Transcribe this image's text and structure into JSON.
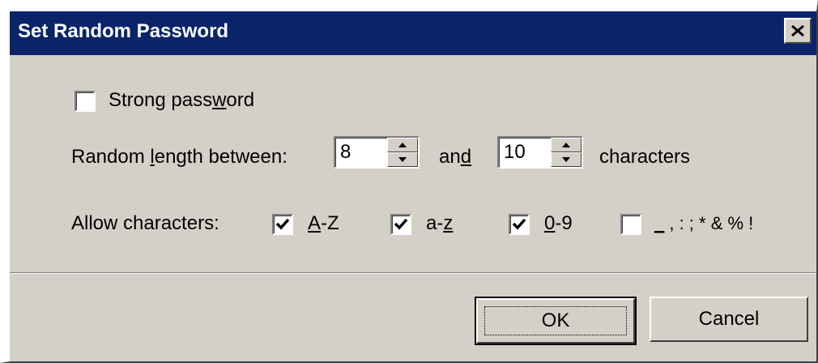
{
  "dialog": {
    "title": "Set Random Password",
    "close_glyph": "✕"
  },
  "strong_password": {
    "checked": false,
    "label_pre": "Strong pass",
    "label_u": "w",
    "label_post": "ord"
  },
  "length": {
    "label_pre": "Random ",
    "label_u": "l",
    "label_post": "ength between:",
    "min_value": "8",
    "and_pre": "an",
    "and_u": "d",
    "max_value": "10",
    "suffix": "characters"
  },
  "allow": {
    "label": "Allow characters:",
    "options": [
      {
        "u": "A",
        "rest": "-Z",
        "checked": true
      },
      {
        "pre": "a-",
        "u": "z",
        "checked": true
      },
      {
        "u": "0",
        "rest": "-9",
        "checked": true
      },
      {
        "u": "_",
        "rest": " , : ; * & % !",
        "checked": false
      }
    ]
  },
  "buttons": {
    "ok": "OK",
    "cancel": "Cancel"
  },
  "icons": {
    "close": "close-icon",
    "check": "check-icon",
    "spin_up": "up-arrow-icon",
    "spin_down": "down-arrow-icon"
  }
}
